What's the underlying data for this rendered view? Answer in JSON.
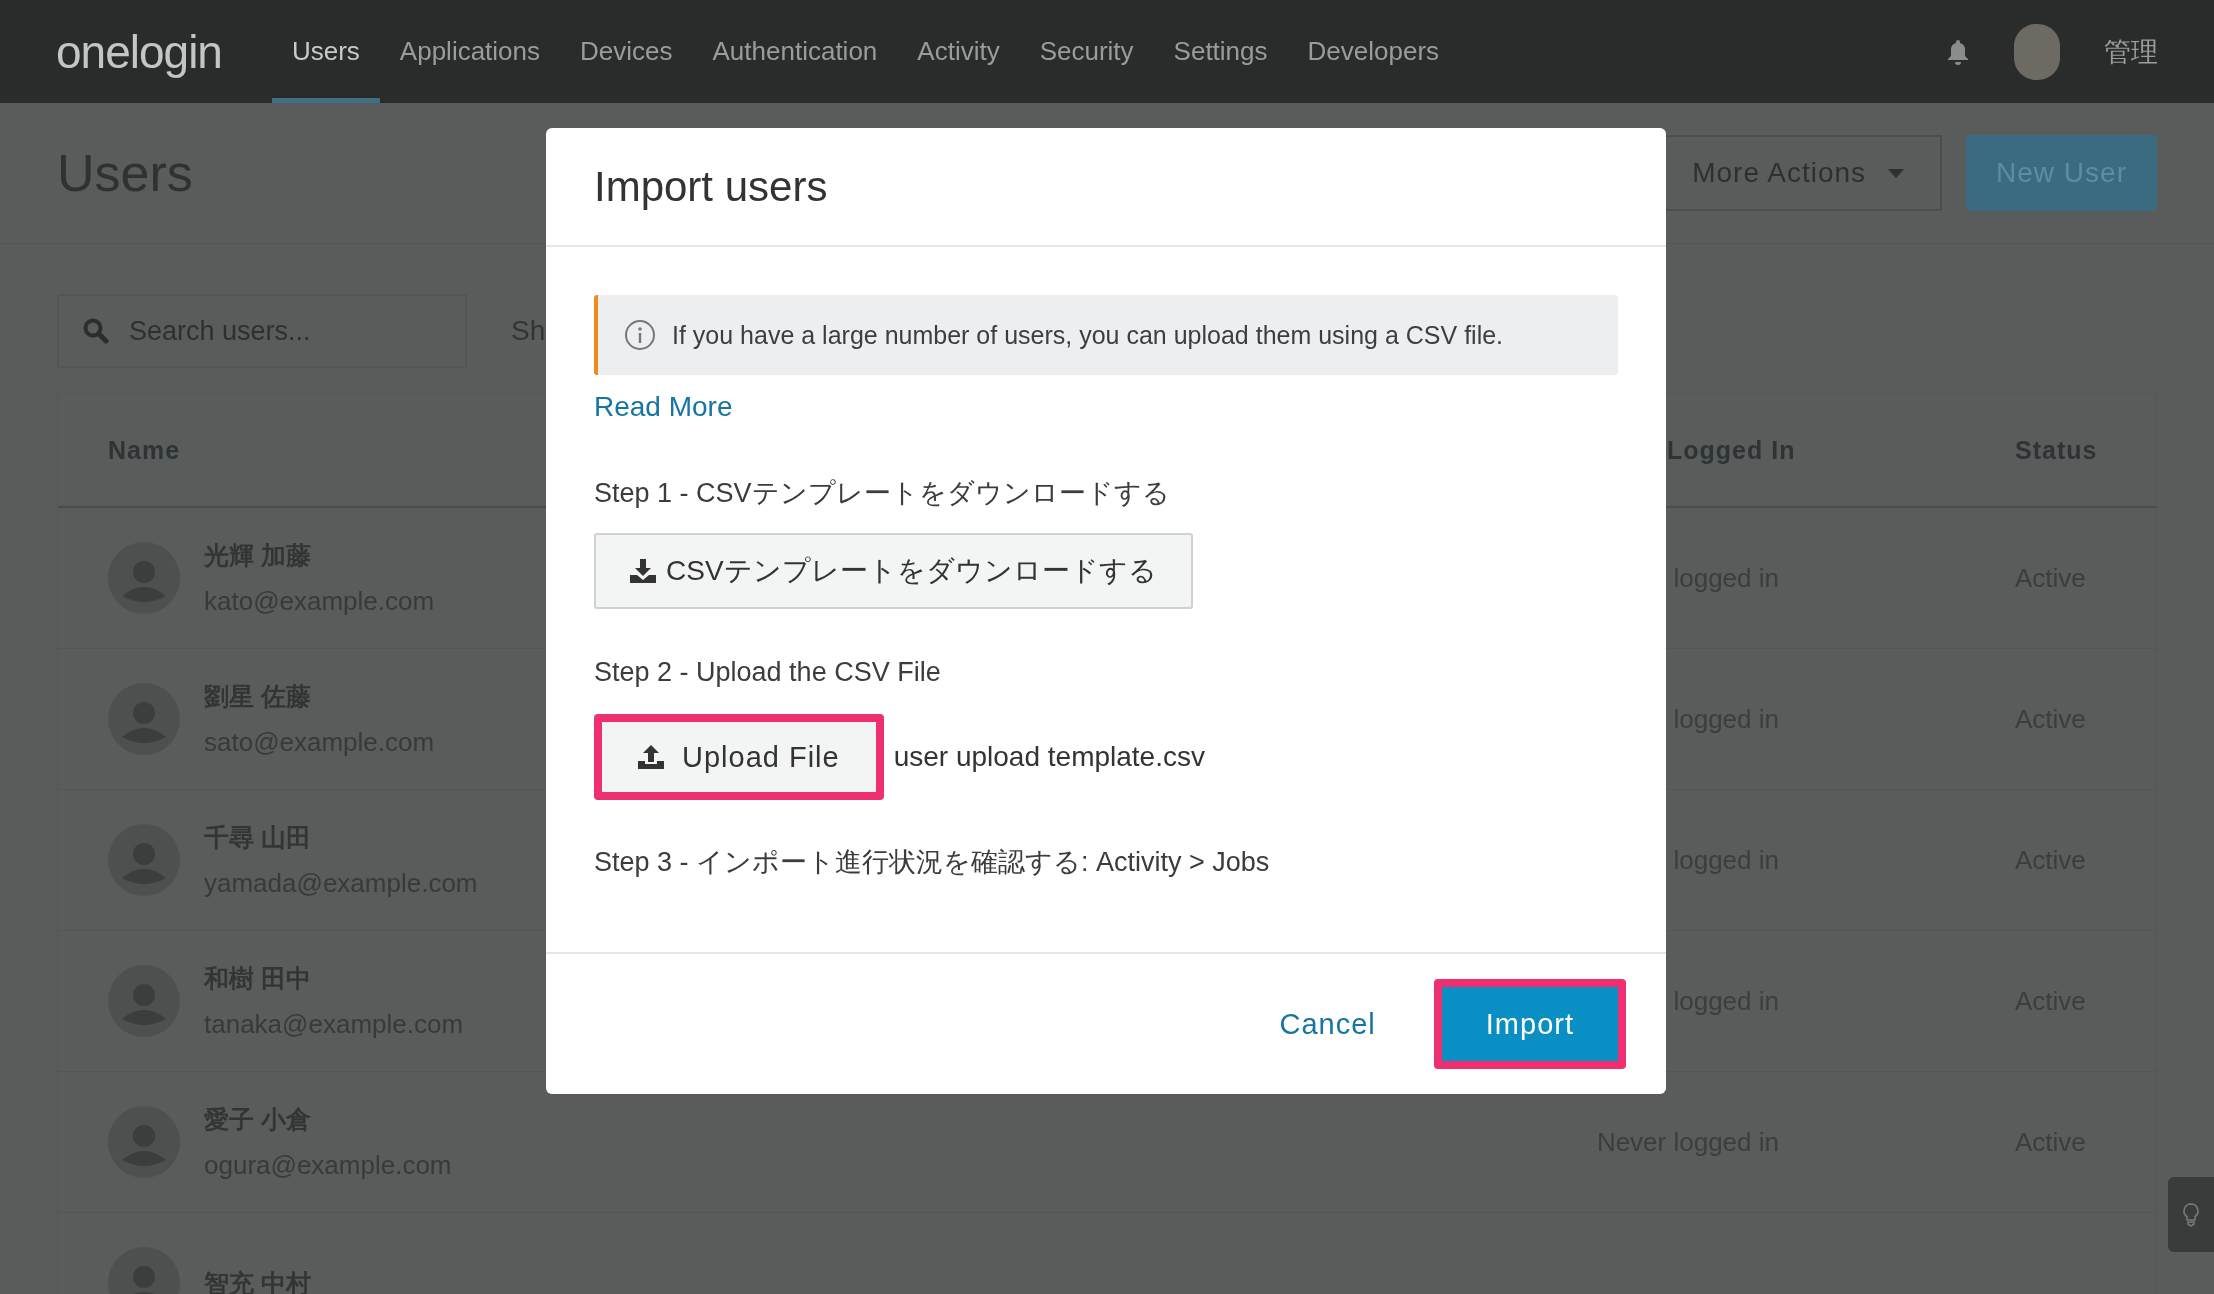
{
  "nav": {
    "logo": "onelogin",
    "items": [
      {
        "label": "Users",
        "selected": true
      },
      {
        "label": "Applications",
        "selected": false
      },
      {
        "label": "Devices",
        "selected": false
      },
      {
        "label": "Authentication",
        "selected": false
      },
      {
        "label": "Activity",
        "selected": false
      },
      {
        "label": "Security",
        "selected": false
      },
      {
        "label": "Settings",
        "selected": false
      },
      {
        "label": "Developers",
        "selected": false
      }
    ],
    "user_name": "管理"
  },
  "page": {
    "title": "Users",
    "more_actions": "More Actions",
    "new_user": "New User",
    "search": {
      "placeholder": "Search users..."
    },
    "filter_label": "Sh"
  },
  "table": {
    "columns": [
      "Name",
      "Logged In",
      "Status"
    ],
    "rows": [
      {
        "name": "光輝 加藤",
        "email": "kato@example.com",
        "logged_in": "logged in",
        "status": "Active"
      },
      {
        "name": "劉星 佐藤",
        "email": "sato@example.com",
        "logged_in": "logged in",
        "status": "Active"
      },
      {
        "name": "千尋 山田",
        "email": "yamada@example.com",
        "logged_in": "logged in",
        "status": "Active"
      },
      {
        "name": "和樹 田中",
        "email": "tanaka@example.com",
        "logged_in": "logged in",
        "status": "Active"
      },
      {
        "name": "愛子 小倉",
        "email": "ogura@example.com",
        "logged_in": "Never logged in",
        "status": "Active"
      },
      {
        "name": "智充 中村"
      }
    ]
  },
  "modal": {
    "title": "Import users",
    "info": "If you have a large number of users, you can upload them using a CSV file.",
    "read_more": "Read More",
    "step1": "Step 1 - CSVテンプレートをダウンロードする",
    "download_button": "CSVテンプレートをダウンロードする",
    "step2": "Step 2 - Upload the CSV File",
    "upload_button": {
      "label": "Upload File",
      "highlighted": true
    },
    "file_name": "user upload template.csv",
    "step3": "Step 3 - インポート進行状況を確認する: Activity > Jobs",
    "cancel": "Cancel",
    "import_button": {
      "label": "Import",
      "highlighted": true
    }
  }
}
